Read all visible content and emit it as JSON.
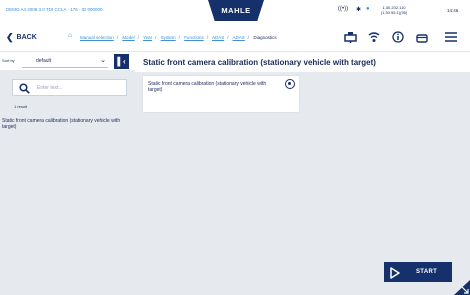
{
  "status_bar": {
    "vehicle": "DEMO A4 2008 3.0 TDI CCLA - 176 - ID 000000",
    "brand": "MAHLE",
    "ip": "1.30.202.110\n(1.30.95.1)(95)",
    "time": "14:46"
  },
  "nav": {
    "back_label": "BACK",
    "breadcrumbs": [
      "Manual selection",
      "Model",
      "Year",
      "System",
      "Functions",
      "ADAS",
      "ADAS"
    ],
    "current": "Diagnostics"
  },
  "sidebar": {
    "sort_label": "Sort by",
    "sort_value": "default",
    "search_placeholder": "Enter text...",
    "results_count": "1 result",
    "items": [
      {
        "label": "Static front camera calibration (stationary vehicle with target)"
      }
    ]
  },
  "main": {
    "title": "Static front camera calibration (stationary vehicle with target)",
    "cards": [
      {
        "label": "Static front camera calibration (stationary vehicle with target)",
        "selected": true
      }
    ],
    "start_label": "START"
  },
  "colors": {
    "primary": "#16306b",
    "link": "#3f8fd6",
    "panel_bg": "#e6e9ee"
  }
}
